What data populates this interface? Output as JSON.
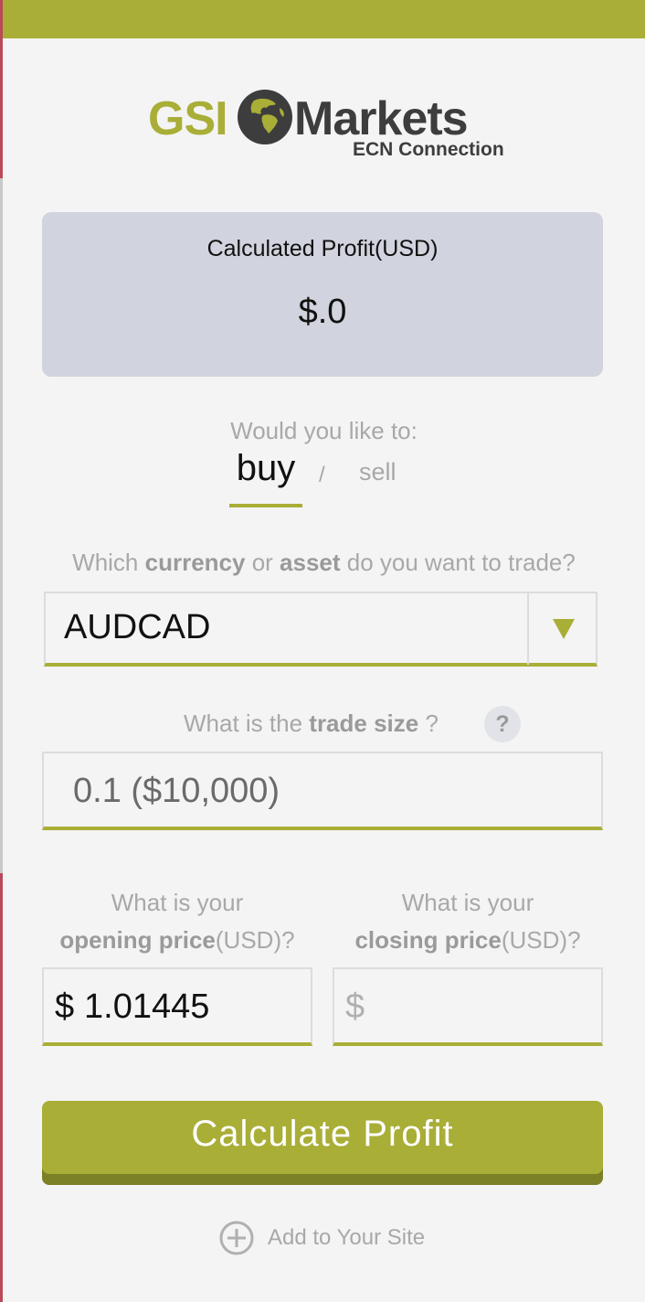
{
  "logo": {
    "brand_left": "GSI",
    "brand_right": "Markets",
    "tagline": "ECN Connection",
    "colors": {
      "accent": "#a9ae37",
      "dark": "#3d3d3d"
    }
  },
  "profit": {
    "label": "Calculated Profit(USD)",
    "value": "$.0"
  },
  "direction": {
    "question": "Would you like to:",
    "options": [
      "buy",
      "sell"
    ],
    "separator": "/",
    "selected": "buy"
  },
  "asset": {
    "question_pre": "Which ",
    "question_b1": "currency",
    "question_mid": " or ",
    "question_b2": "asset",
    "question_post": " do you want to trade?",
    "selected": "AUDCAD",
    "arrow_icon": "triangle-down-icon"
  },
  "trade_size": {
    "question_pre": "What is the ",
    "question_bold": "trade size",
    "question_post": " ?",
    "help_icon": "?",
    "value": "0.1 ($10,000)"
  },
  "opening_price": {
    "line1": "What is your",
    "bold": "opening price",
    "suffix": "(USD)?",
    "currency": "$",
    "value": "1.01445"
  },
  "closing_price": {
    "line1": "What is your",
    "bold": "closing price",
    "suffix": "(USD)?",
    "currency": "$",
    "value": ""
  },
  "calculate_button": {
    "label": "Calculate Profit"
  },
  "add_site": {
    "label": "Add to Your Site",
    "icon": "plus-circle-icon"
  }
}
